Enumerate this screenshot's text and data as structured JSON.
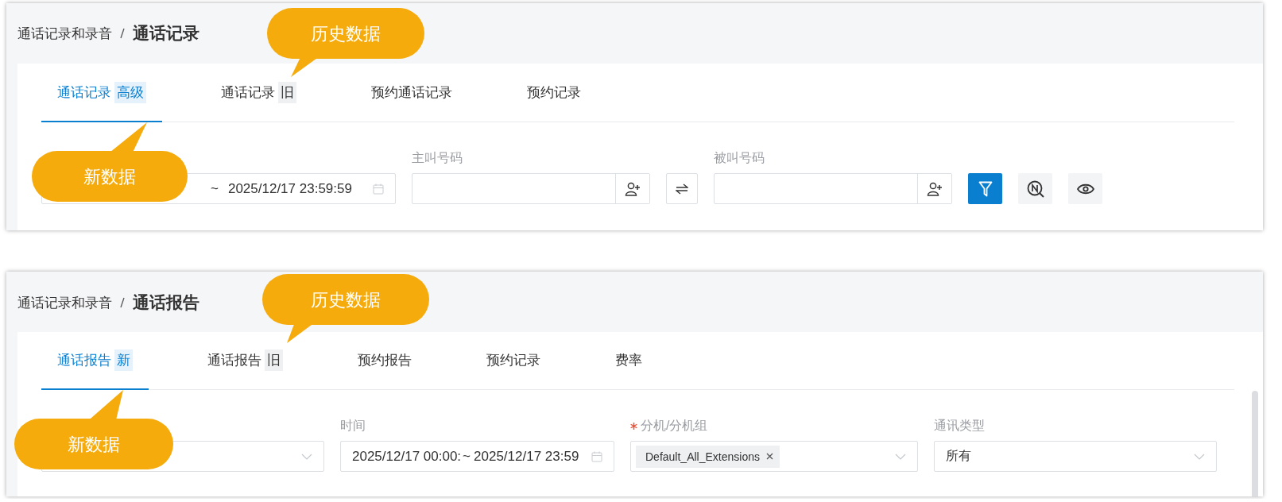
{
  "panels": [
    {
      "breadcrumb": {
        "parent": "通话记录和录音",
        "current": "通话记录"
      },
      "tabs": [
        {
          "label": "通话记录",
          "badge": "高级",
          "selected": true
        },
        {
          "label": "通话记录",
          "badge": "旧",
          "selected": false
        },
        {
          "label": "预约通话记录",
          "selected": false
        },
        {
          "label": "预约记录",
          "selected": false
        }
      ],
      "filters": [
        {
          "kind": "date_range",
          "separator": "~",
          "end": "2025/12/17 23:59:59"
        },
        {
          "kind": "number",
          "label": "主叫号码"
        },
        {
          "kind": "swap"
        },
        {
          "kind": "number",
          "label": "被叫号码"
        },
        {
          "kind": "filter_button"
        },
        {
          "kind": "search_button"
        },
        {
          "kind": "eye_button"
        }
      ],
      "callouts": [
        "历史数据",
        "新数据"
      ]
    },
    {
      "breadcrumb": {
        "parent": "通话记录和录音",
        "current": "通话报告"
      },
      "tabs": [
        {
          "label": "通话报告",
          "badge": "新",
          "selected": true
        },
        {
          "label": "通话报告",
          "badge": "旧",
          "selected": false
        },
        {
          "label": "预约报告",
          "selected": false
        },
        {
          "label": "预约记录",
          "selected": false
        },
        {
          "label": "费率",
          "selected": false
        }
      ],
      "filters": [
        {
          "kind": "select"
        },
        {
          "kind": "date_range",
          "label": "时间",
          "start": "2025/12/17 00:00:",
          "separator": "~",
          "end": "2025/12/17 23:59"
        },
        {
          "kind": "tag_select",
          "label": "分机/分机组",
          "required": true,
          "tag": "Default_All_Extensions"
        },
        {
          "kind": "select",
          "label": "通讯类型",
          "value": "所有"
        }
      ],
      "callouts": [
        "历史数据",
        "新数据"
      ]
    }
  ]
}
